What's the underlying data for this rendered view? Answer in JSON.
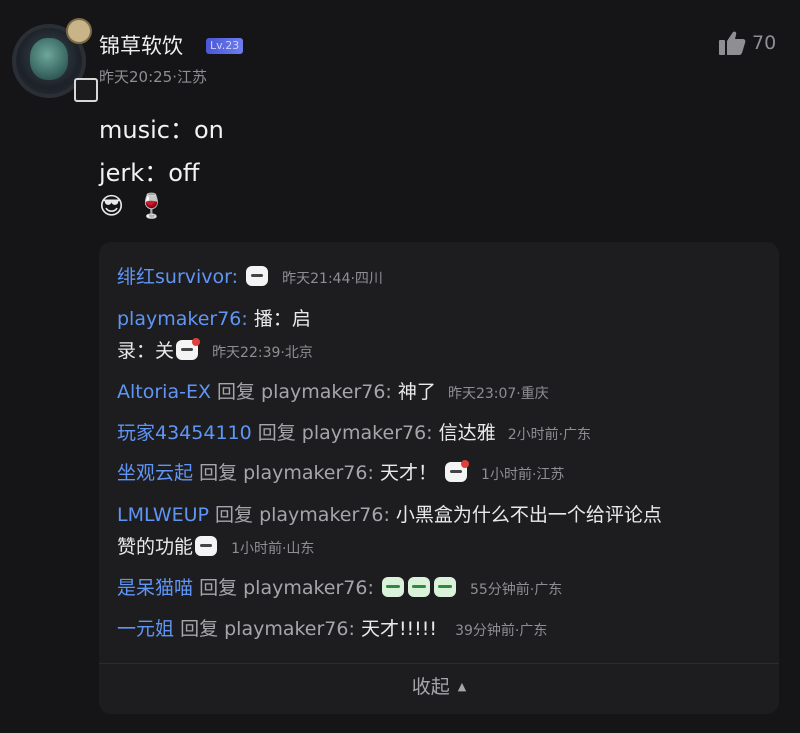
{
  "post": {
    "author": "锦草软饮",
    "level": "Lv.23",
    "meta": "昨天20:25·江苏",
    "likes": "70",
    "lines": [
      "music：on",
      "jerk：off"
    ],
    "emojis": [
      "😎",
      "🍷"
    ]
  },
  "replies": [
    {
      "user": "绯红survivor:",
      "reply_to": "",
      "text": "",
      "stickers": [
        "plain"
      ],
      "meta": "昨天21:44·四川"
    },
    {
      "user": "playmaker76:",
      "reply_to": "",
      "text": "播：启",
      "text2": "录：关",
      "stickers": [
        "red"
      ],
      "meta": "昨天22:39·北京"
    },
    {
      "user": "Altoria-EX",
      "reply_to": "回复 playmaker76:",
      "text": "神了",
      "stickers": [],
      "meta": "昨天23:07·重庆"
    },
    {
      "user": "玩家43454110",
      "reply_to": "回复 playmaker76:",
      "text": "信达雅",
      "stickers": [],
      "meta": "2小时前·广东"
    },
    {
      "user": "坐观云起",
      "reply_to": "回复 playmaker76:",
      "text": "天才！",
      "stickers": [
        "red"
      ],
      "meta": "1小时前·江苏"
    },
    {
      "user": "LMLWEUP",
      "reply_to": "回复 playmaker76:",
      "text": "小黑盒为什么不出一个给评论点",
      "text2": "赞的功能",
      "stickers": [
        "plain"
      ],
      "meta": "1小时前·山东"
    },
    {
      "user": "是呆猫喵",
      "reply_to": "回复 playmaker76:",
      "text": "",
      "stickers": [
        "green",
        "green",
        "green"
      ],
      "meta": "55分钟前·广东"
    },
    {
      "user": "一元姐",
      "reply_to": "回复 playmaker76:",
      "text": "天才!!!!!",
      "stickers": [],
      "meta": "39分钟前·广东"
    }
  ],
  "collapse_label": "收起",
  "icons": {
    "like": "thumbs-up-icon",
    "collapse": "caret-up-icon"
  },
  "colors": {
    "username_link": "#5f95f5",
    "background": "#151517",
    "reply_panel": "#1d1d20"
  }
}
